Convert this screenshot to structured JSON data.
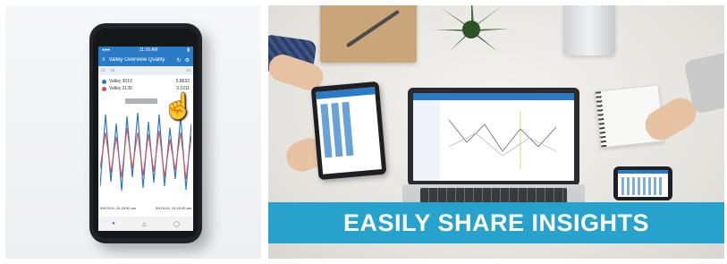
{
  "left_panel": {
    "app_title": "Valley Overview Quality",
    "legend": [
      {
        "name": "Valley 3010",
        "value": "5.8632",
        "color": "#2a7bc6"
      },
      {
        "name": "Valley 3130",
        "value": "3.1011",
        "color": "#e04b4b"
      }
    ],
    "time_start": "09/13/19, 10:18:00 am",
    "time_end": "09/19/19, 10:18:00 am",
    "status_time": "11:16 AM"
  },
  "right_panel": {
    "banner_text": "EASILY SHARE INSIGHTS",
    "banner_color": "#27a2cc"
  }
}
